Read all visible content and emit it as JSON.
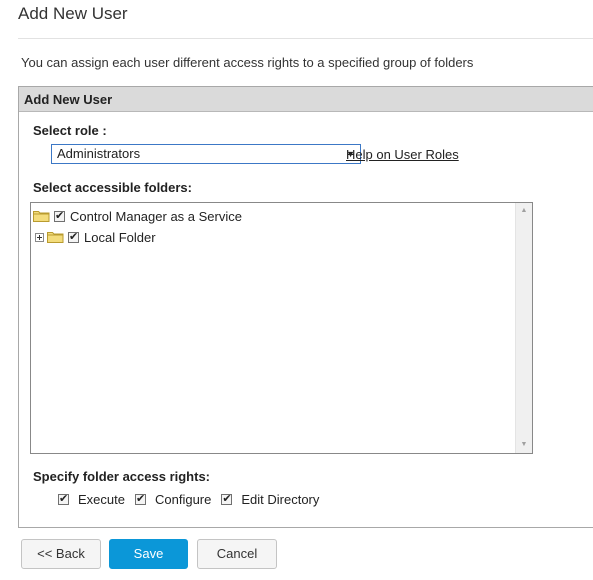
{
  "page": {
    "title": "Add New User",
    "description": "You can assign each user different access rights to a specified group of folders"
  },
  "panel": {
    "header": "Add New User",
    "role_label": "Select role :",
    "role_selected": "Administrators",
    "help_link": "Help on User Roles",
    "folders_label": "Select accessible folders:",
    "tree": [
      {
        "label": "Control Manager as a Service",
        "checked": true,
        "expandable": false,
        "level": 0
      },
      {
        "label": "Local Folder",
        "checked": true,
        "expandable": true,
        "level": 1
      }
    ],
    "rights_label": "Specify folder access rights:",
    "rights": [
      {
        "label": "Execute",
        "checked": true
      },
      {
        "label": "Configure",
        "checked": true
      },
      {
        "label": "Edit Directory",
        "checked": true
      }
    ]
  },
  "buttons": {
    "back": "<< Back",
    "save": "Save",
    "cancel": "Cancel"
  },
  "colors": {
    "accent": "#0b97d8",
    "header_bg": "#dadada",
    "select_border": "#3c78c6"
  }
}
